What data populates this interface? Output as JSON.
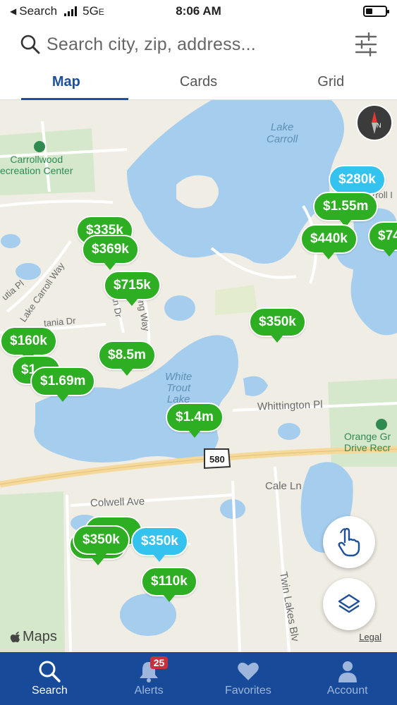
{
  "status_bar": {
    "back_label": "Search",
    "network": "5G",
    "network_sub": "E",
    "time": "8:06 AM"
  },
  "search": {
    "placeholder": "Search city, zip, address..."
  },
  "tabs": [
    {
      "label": "Map",
      "active": true
    },
    {
      "label": "Cards",
      "active": false
    },
    {
      "label": "Grid",
      "active": false
    }
  ],
  "map": {
    "labels": {
      "lake_carroll": "Lake\nCarroll",
      "carrollwood_park": "Carrollwood\necreation Center",
      "white_trout": "White\nTrout\nLake",
      "orange_grove": "Orange Gr\nDrive Recr",
      "whittington": "Whittington Pl",
      "cale": "Cale Ln",
      "colwell": "Colwell Ave",
      "twin_lakes": "Twin Lakes Blv",
      "lake_carroll_way": "Lake Carroll Way",
      "tania": "tania Dr",
      "utia": "utia Pl",
      "long_way": "ong Way",
      "an_dr": "an Dr",
      "croll": "rroll I",
      "route": "580"
    },
    "pins": [
      {
        "price": "$280k",
        "color": "blue"
      },
      {
        "price": "$1.55m",
        "color": "green"
      },
      {
        "price": "$440k",
        "color": "green"
      },
      {
        "price": "$74",
        "color": "green"
      },
      {
        "price": "$335k",
        "color": "green"
      },
      {
        "price": "$369k",
        "color": "green"
      },
      {
        "price": "$715k",
        "color": "green"
      },
      {
        "price": "$350k",
        "color": "green"
      },
      {
        "price": "$160k",
        "color": "green"
      },
      {
        "price": "$1",
        "color": "green"
      },
      {
        "price": "$1.69m",
        "color": "green"
      },
      {
        "price": "$8.5m",
        "color": "green"
      },
      {
        "price": "$1.4m",
        "color": "green"
      },
      {
        "price": "$350k",
        "color": "green"
      },
      {
        "price": "$350k",
        "color": "blue"
      },
      {
        "price": "$110k",
        "color": "green"
      }
    ],
    "attribution": "Maps",
    "legal": "Legal"
  },
  "bottom_nav": [
    {
      "label": "Search",
      "icon": "search-icon",
      "active": true
    },
    {
      "label": "Alerts",
      "icon": "bell-icon",
      "active": false,
      "badge": "25"
    },
    {
      "label": "Favorites",
      "icon": "heart-icon",
      "active": false
    },
    {
      "label": "Account",
      "icon": "person-icon",
      "active": false
    }
  ],
  "colors": {
    "brand_blue": "#174a98",
    "pin_green": "#2eae22",
    "pin_blue": "#34c3ee",
    "water": "#a4cdee"
  }
}
